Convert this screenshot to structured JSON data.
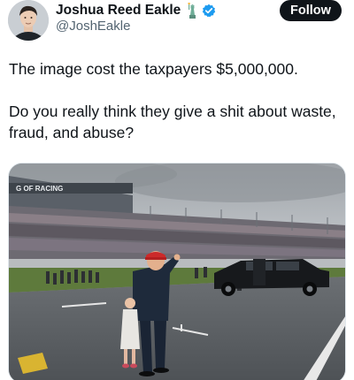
{
  "author": {
    "display_name": "Joshua Reed Eakle",
    "handle": "@JoshEakle",
    "avatar_icon": "person-portrait-avatar",
    "emoji_icon": "statue-of-liberty-icon",
    "verified_icon": "verified-badge-icon",
    "verified_color": "#1d9bf0"
  },
  "follow_label": "Follow",
  "tweet": {
    "line1": "The image cost the taxpayers $5,000,000.",
    "line2": "Do you really think they give a shit about waste, fraud, and abuse?"
  },
  "media": {
    "stand_sign_text": "G OF RACING"
  }
}
